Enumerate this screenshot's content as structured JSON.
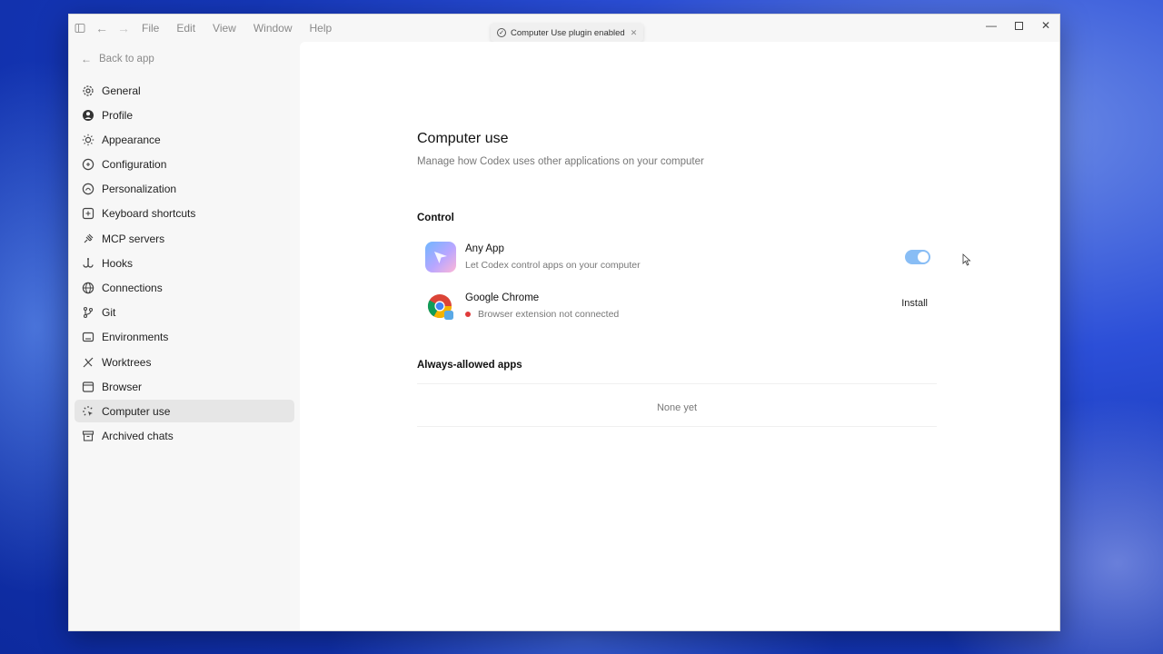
{
  "toast": {
    "text": "Computer Use plugin enabled"
  },
  "menu": [
    "File",
    "Edit",
    "View",
    "Window",
    "Help"
  ],
  "back_label": "Back to app",
  "nav": [
    {
      "label": "General",
      "icon": "gear-icon"
    },
    {
      "label": "Profile",
      "icon": "user-icon"
    },
    {
      "label": "Appearance",
      "icon": "sun-icon"
    },
    {
      "label": "Configuration",
      "icon": "config-icon"
    },
    {
      "label": "Personalization",
      "icon": "personalization-icon"
    },
    {
      "label": "Keyboard shortcuts",
      "icon": "keyboard-icon"
    },
    {
      "label": "MCP servers",
      "icon": "plug-icon"
    },
    {
      "label": "Hooks",
      "icon": "hook-icon"
    },
    {
      "label": "Connections",
      "icon": "globe-icon"
    },
    {
      "label": "Git",
      "icon": "branch-icon"
    },
    {
      "label": "Environments",
      "icon": "environment-icon"
    },
    {
      "label": "Worktrees",
      "icon": "worktree-icon"
    },
    {
      "label": "Browser",
      "icon": "browser-icon"
    },
    {
      "label": "Computer use",
      "icon": "cursor-icon",
      "active": true
    },
    {
      "label": "Archived chats",
      "icon": "archive-icon"
    }
  ],
  "page": {
    "title": "Computer use",
    "subtitle": "Manage how Codex uses other applications on your computer",
    "control_heading": "Control",
    "apps": [
      {
        "name": "Any App",
        "desc": "Let Codex control apps on your computer",
        "enabled": true
      },
      {
        "name": "Google Chrome",
        "desc": "Browser extension not connected",
        "action": "Install",
        "status_color": "#e03a3a"
      }
    ],
    "allowed_heading": "Always-allowed apps",
    "allowed_empty": "None yet"
  },
  "colors": {
    "toggle_on": "#88bdf5",
    "active_nav": "#e6e6e6"
  }
}
